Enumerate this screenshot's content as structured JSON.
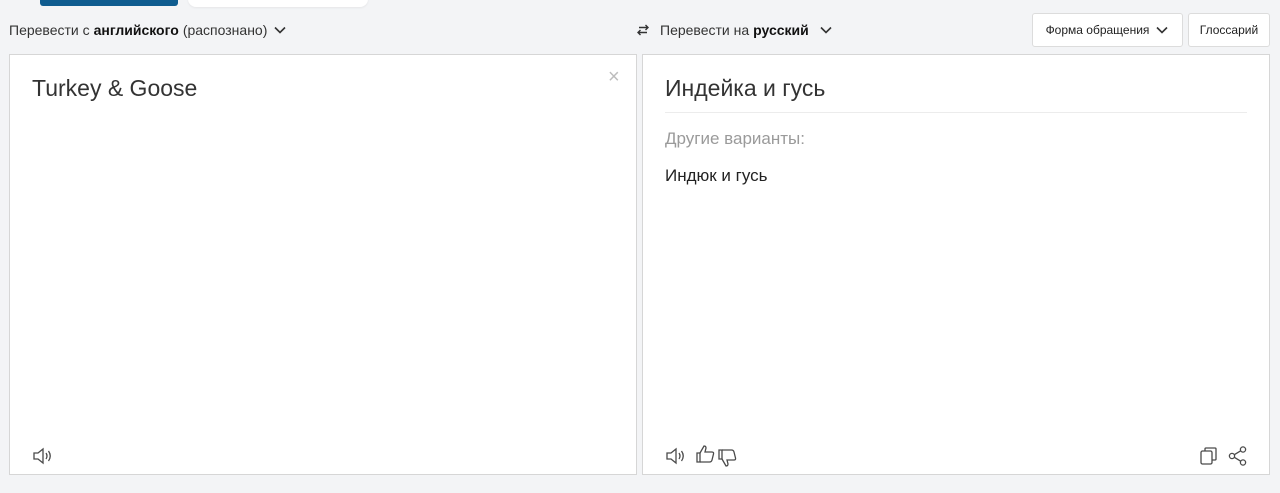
{
  "source": {
    "prefix": "Перевести с",
    "language": "английского",
    "suffix": "(распознано)",
    "text": "Turkey & Goose"
  },
  "target": {
    "prefix": "Перевести на",
    "language": "русский",
    "text": "Индейка и гусь",
    "alternatives_label": "Другие варианты:",
    "alternatives": [
      "Индюк и гусь"
    ]
  },
  "buttons": {
    "formality": "Форма обращения",
    "glossary": "Глоссарий"
  },
  "colors": {
    "accent": "#0f5c8f",
    "icon": "#4a4a4a"
  },
  "icons": [
    "chevron-down-icon",
    "swap-icon",
    "close-icon",
    "speaker-icon",
    "thumbs-up-icon",
    "thumbs-down-icon",
    "copy-icon",
    "share-icon"
  ]
}
